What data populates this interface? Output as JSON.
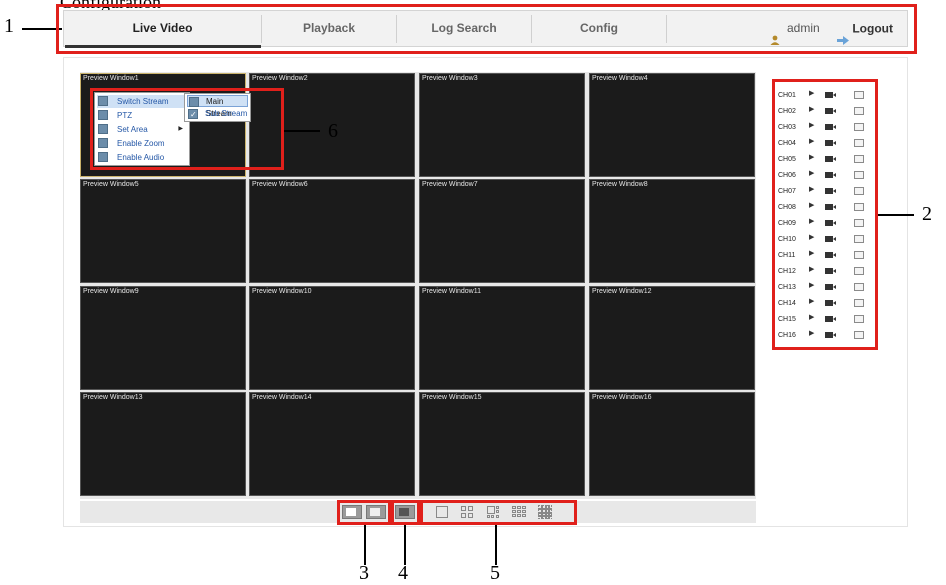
{
  "header_fragment": "Configuration",
  "navbar": {
    "tabs": [
      "Live Video",
      "Playback",
      "Log Search",
      "Config"
    ],
    "active_tab": "Live Video",
    "user": "admin",
    "logout_label": "Logout"
  },
  "preview_windows": [
    "Preview Window1",
    "Preview Window2",
    "Preview Window3",
    "Preview Window4",
    "Preview Window5",
    "Preview Window6",
    "Preview Window7",
    "Preview Window8",
    "Preview Window9",
    "Preview Window10",
    "Preview Window11",
    "Preview Window12",
    "Preview Window13",
    "Preview Window14",
    "Preview Window15",
    "Preview Window16"
  ],
  "context_menu": {
    "items": [
      "Switch Stream",
      "PTZ",
      "Set Area",
      "Enable Zoom",
      "Enable Audio"
    ],
    "submenu": [
      "Main Stream",
      "Sub Stream"
    ]
  },
  "channels": [
    "CH01",
    "CH02",
    "CH03",
    "CH04",
    "CH05",
    "CH06",
    "CH07",
    "CH08",
    "CH09",
    "CH10",
    "CH11",
    "CH12",
    "CH13",
    "CH14",
    "CH15",
    "CH16"
  ],
  "callouts": [
    "1",
    "2",
    "3",
    "4",
    "5",
    "6"
  ],
  "colors": {
    "callout_box": "#e0201b",
    "video_bg": "#1b1b1b",
    "menu_text": "#2457a6"
  },
  "icons": {
    "user": "user-icon",
    "logout": "logout-icon",
    "record": "record-icon",
    "snapshot": "snapshot-icon",
    "play": "play-icon"
  }
}
